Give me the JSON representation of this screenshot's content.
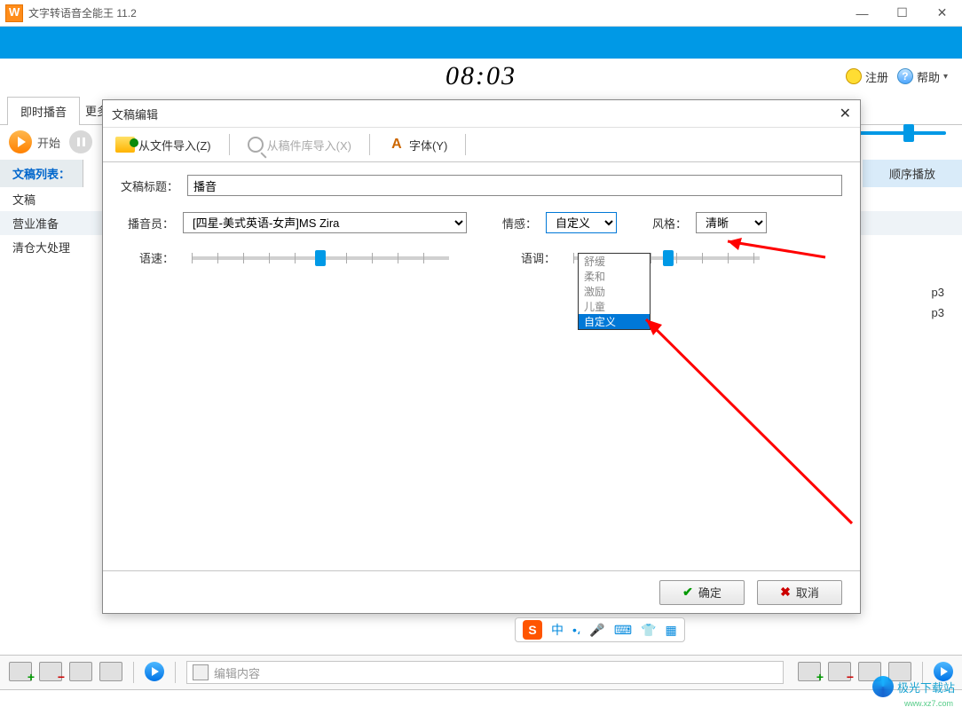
{
  "window": {
    "title": "文字转语音全能王 11.2"
  },
  "clock": "08:03",
  "header": {
    "register": "注册",
    "help": "帮助"
  },
  "tabs": {
    "live": "即时播音",
    "more": "更多"
  },
  "controls": {
    "start": "开始"
  },
  "filelist": {
    "label": "文稿列表：",
    "sequence_play": "顺序播放",
    "items": [
      "文稿",
      "营业准备",
      "清仓大处理"
    ],
    "hidden_suffix": "p3"
  },
  "dialog": {
    "title": "文稿编辑",
    "toolbar": {
      "import_file": "从文件导入(Z)",
      "import_lib": "从稿件库导入(X)",
      "font": "字体(Y)"
    },
    "fields": {
      "title_label": "文稿标题：",
      "title_value": "播音",
      "announcer_label": "播音员：",
      "announcer_value": "[四星-美式英语-女声]MS Zira",
      "emotion_label": "情感：",
      "emotion_value": "自定义",
      "style_label": "风格：",
      "style_value": "清晰",
      "speed_label": "语速：",
      "tone_label": "语调："
    },
    "emotion_options": [
      "舒缓",
      "柔和",
      "激励",
      "儿童",
      "自定义"
    ],
    "buttons": {
      "ok": "确定",
      "cancel": "取消"
    }
  },
  "bottombar": {
    "edit_placeholder": "编辑内容"
  },
  "ime": {
    "logo": "S",
    "zhong": "中"
  },
  "watermark": {
    "text": "极光下载站",
    "sub": "www.xz7.com"
  }
}
